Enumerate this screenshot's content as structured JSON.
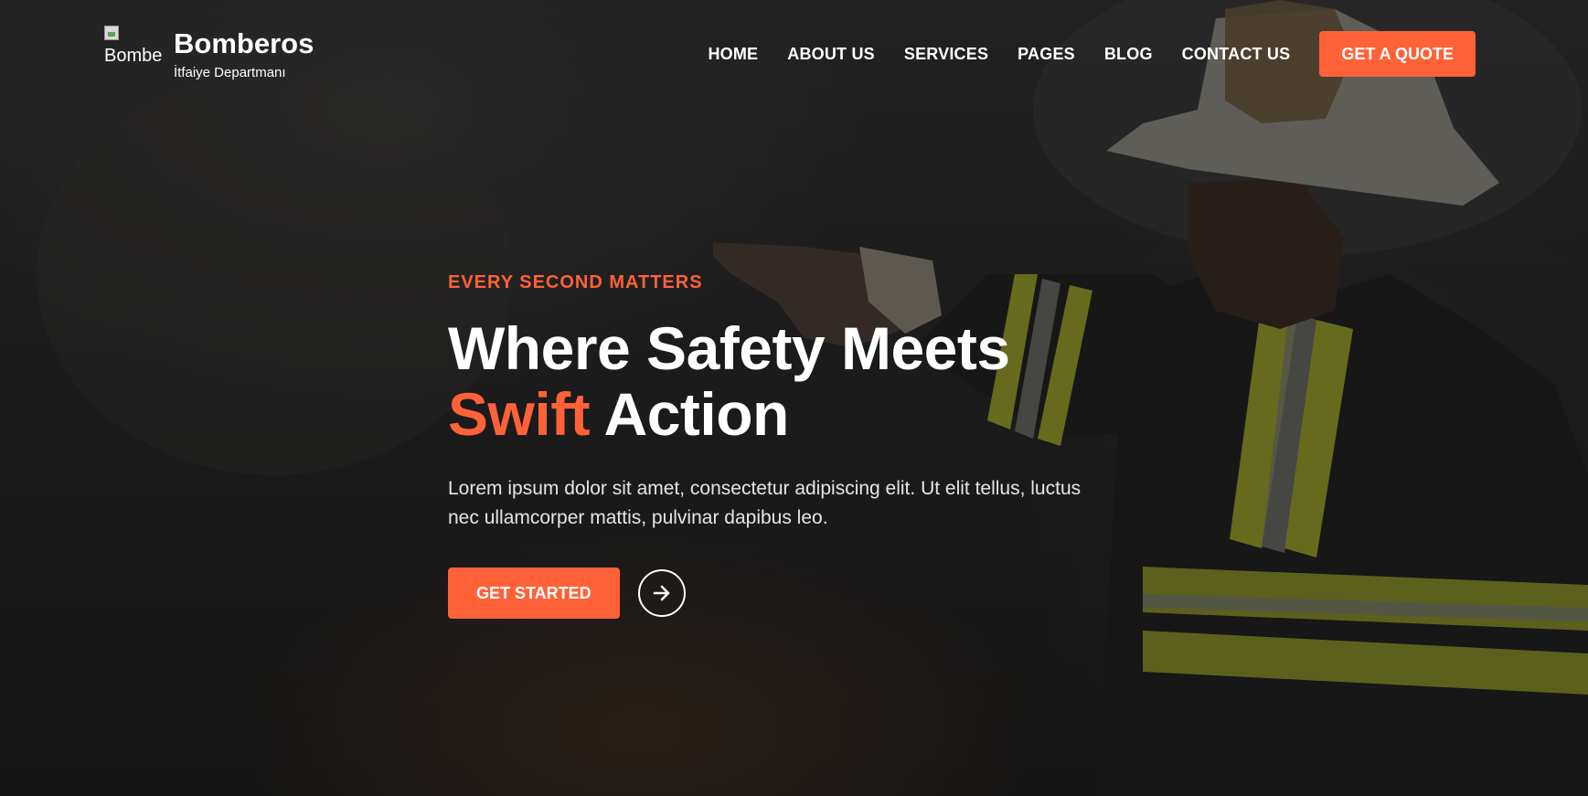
{
  "brand": {
    "logo_alt": "Bomberos Logo",
    "name": "Bomberos",
    "subtitle": "İtfaiye Departmanı"
  },
  "nav": {
    "items": [
      {
        "label": "HOME"
      },
      {
        "label": "ABOUT US"
      },
      {
        "label": "SERVICES"
      },
      {
        "label": "PAGES"
      },
      {
        "label": "BLOG"
      },
      {
        "label": "CONTACT US"
      }
    ],
    "cta_label": "GET A QUOTE"
  },
  "hero": {
    "eyebrow": "EVERY SECOND MATTERS",
    "title_line1": "Where Safety Meets",
    "title_accent": "Swift",
    "title_rest": "Action",
    "description_line1": "Lorem ipsum dolor sit amet, consectetur adipiscing elit. Ut elit tellus, luctus",
    "description_line2": "nec ullamcorper mattis, pulvinar dapibus leo.",
    "cta_label": "GET STARTED",
    "arrow_icon": "arrow-right-icon"
  },
  "colors": {
    "accent": "#ff6138",
    "text": "#ffffff"
  }
}
